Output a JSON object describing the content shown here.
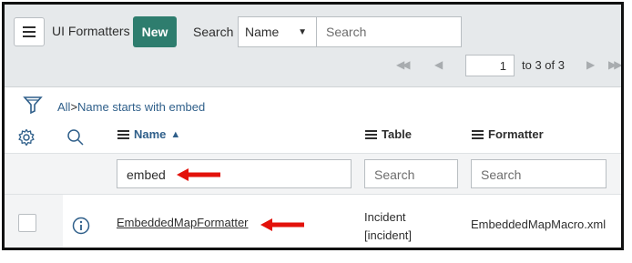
{
  "header": {
    "title": "UI Formatters",
    "new_label": "New",
    "search_label": "Search",
    "field_select": "Name",
    "search_placeholder": "Search"
  },
  "pagination": {
    "page_value": "1",
    "range_text": "to 3 of 3"
  },
  "breadcrumb": {
    "all": "All",
    "separator": ">",
    "filter": "Name starts with embed"
  },
  "columns": {
    "name": "Name",
    "table": "Table",
    "formatter": "Formatter"
  },
  "column_search": {
    "name_value": "embed",
    "table_placeholder": "Search",
    "formatter_placeholder": "Search"
  },
  "rows": [
    {
      "name": "EmbeddedMapFormatter",
      "table_line1": "Incident",
      "table_line2": "[incident]",
      "formatter": "EmbeddedMapMacro.xml"
    }
  ],
  "colors": {
    "new_button": "#2e7d6e",
    "annotation_arrow": "#e3120b",
    "link": "#2f5f8a"
  }
}
